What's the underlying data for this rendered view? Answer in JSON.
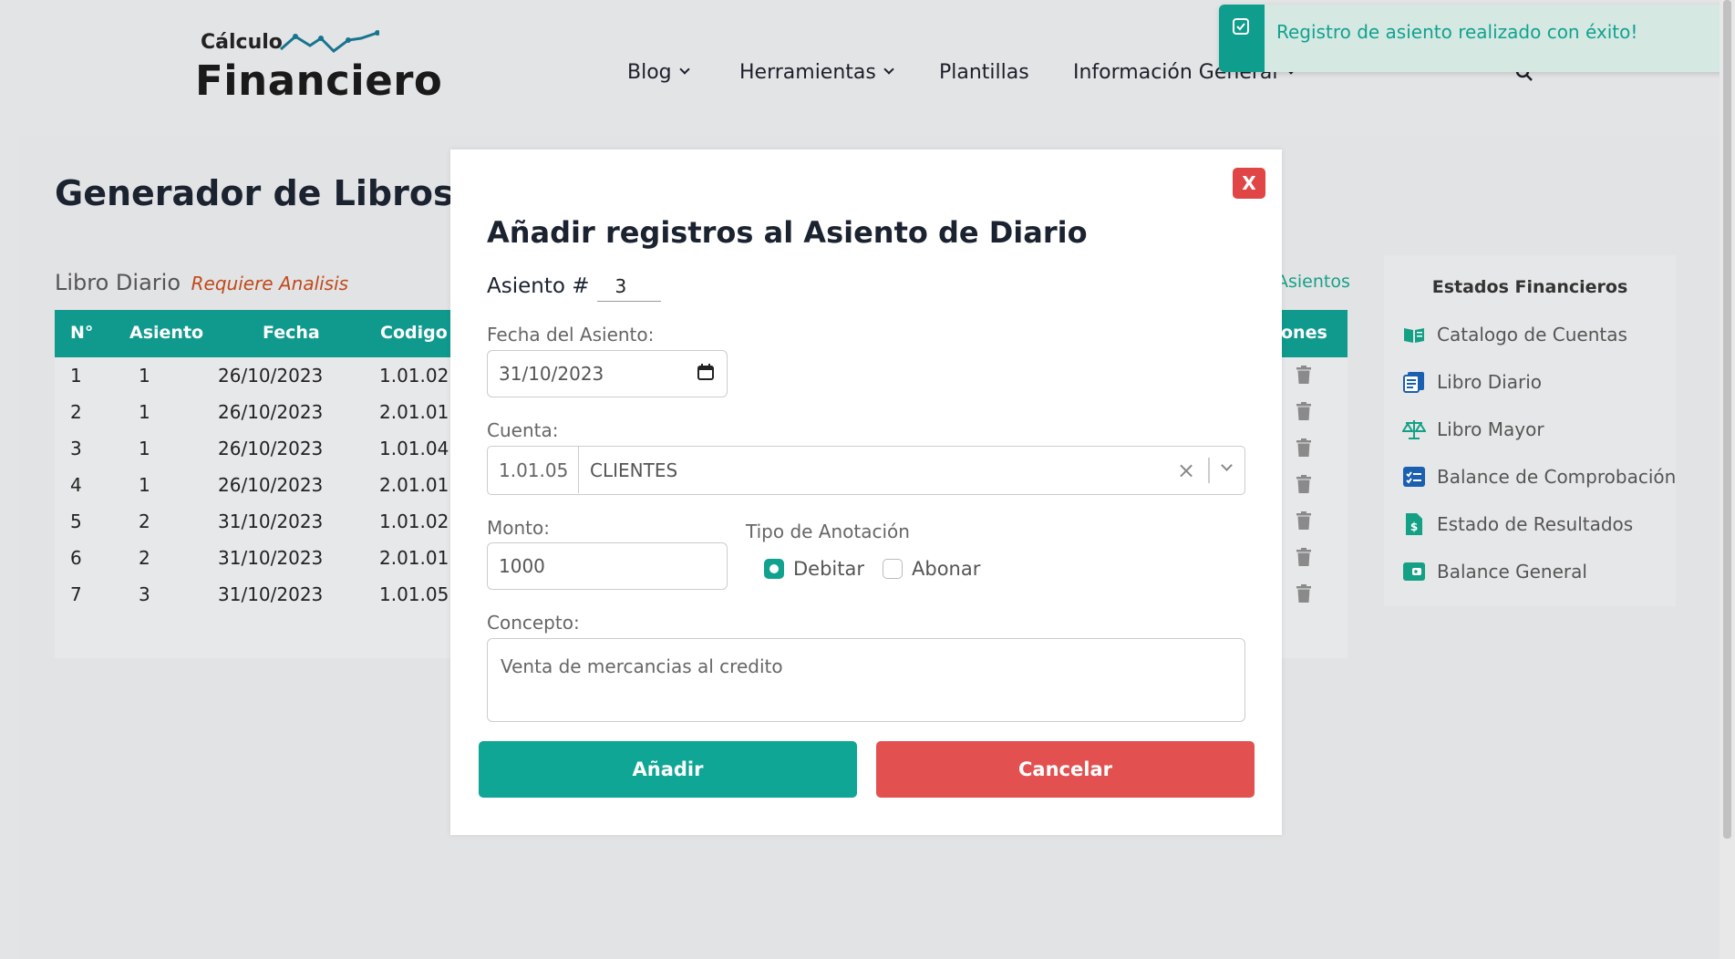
{
  "logo": {
    "small": "Cálculo",
    "big": "Financiero"
  },
  "nav": {
    "items": [
      {
        "label": "Blog",
        "dropdown": true
      },
      {
        "label": "Herramientas",
        "dropdown": true
      },
      {
        "label": "Plantillas",
        "dropdown": false
      },
      {
        "label": "Información General",
        "dropdown": true
      }
    ]
  },
  "page": {
    "title": "Generador de Libros y E",
    "section": "Libro Diario",
    "section_note": "Requiere Analisis",
    "asientos_link": "Asientos"
  },
  "table": {
    "headers": [
      "N°",
      "Asiento",
      "Fecha",
      "Codigo",
      "ones"
    ],
    "rows": [
      [
        "1",
        "1",
        "26/10/2023",
        "1.01.02"
      ],
      [
        "2",
        "1",
        "26/10/2023",
        "2.01.01"
      ],
      [
        "3",
        "1",
        "26/10/2023",
        "1.01.04"
      ],
      [
        "4",
        "1",
        "26/10/2023",
        "2.01.01"
      ],
      [
        "5",
        "2",
        "31/10/2023",
        "1.01.02"
      ],
      [
        "6",
        "2",
        "31/10/2023",
        "2.01.01"
      ],
      [
        "7",
        "3",
        "31/10/2023",
        "1.01.05"
      ]
    ]
  },
  "sidebar": {
    "title": "Estados Financieros",
    "items": [
      {
        "label": "Catalogo de Cuentas",
        "icon": "book-open-icon"
      },
      {
        "label": "Libro Diario",
        "icon": "journal-icon"
      },
      {
        "label": "Libro Mayor",
        "icon": "scale-icon"
      },
      {
        "label": "Balance de Comprobación",
        "icon": "checklist-icon"
      },
      {
        "label": "Estado de Resultados",
        "icon": "invoice-dollar-icon"
      },
      {
        "label": "Balance General",
        "icon": "wallet-icon"
      }
    ]
  },
  "modal": {
    "close": "X",
    "title": "Añadir registros al Asiento de Diario",
    "asiento_label": "Asiento #",
    "asiento_value": "3",
    "fecha_label": "Fecha del Asiento:",
    "fecha_value": "31/10/2023",
    "cuenta_label": "Cuenta:",
    "cuenta_code": "1.01.05",
    "cuenta_name": "CLIENTES",
    "monto_label": "Monto:",
    "monto_value": "1000",
    "tipo_label": "Tipo de Anotación",
    "debitar": "Debitar",
    "abonar": "Abonar",
    "selected_tipo": "Debitar",
    "concepto_label": "Concepto:",
    "concepto_value": "Venta de mercancias al credito",
    "add_button": "Añadir",
    "cancel_button": "Cancelar"
  },
  "toast": {
    "message": "Registro de asiento realizado con éxito!"
  },
  "colors": {
    "accent": "#0f9a8d",
    "danger": "#e04646",
    "note": "#c0491b"
  }
}
